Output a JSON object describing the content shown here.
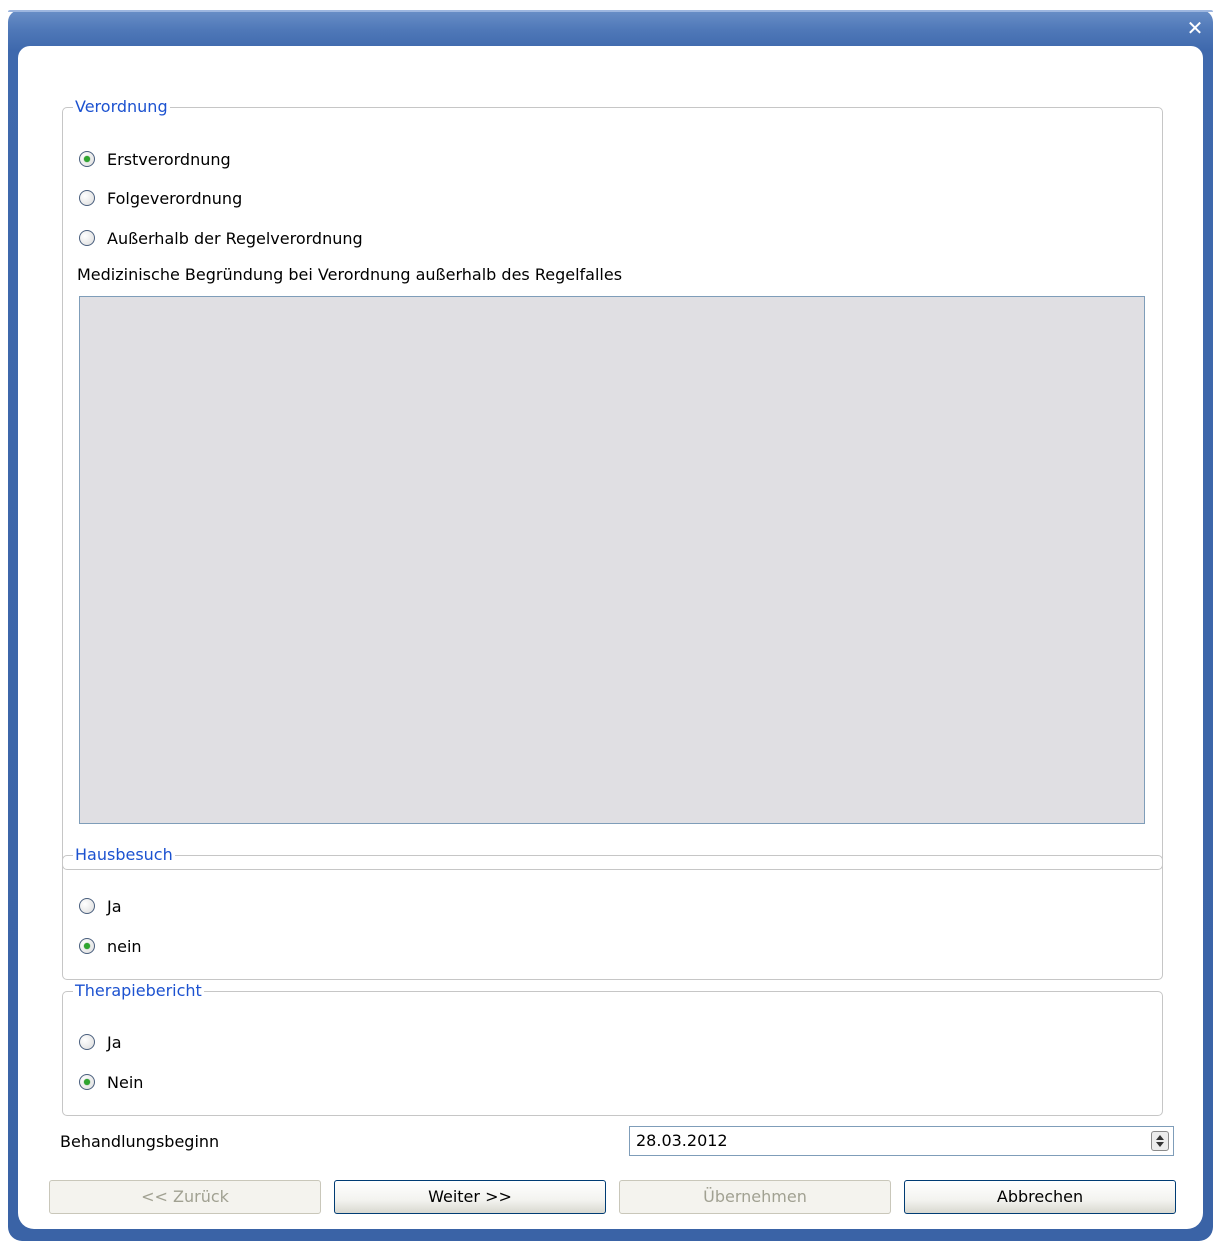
{
  "window": {
    "close_symbol": "✕"
  },
  "verordnung": {
    "legend": "Verordnung",
    "options": [
      {
        "label": "Erstverordnung",
        "checked": true
      },
      {
        "label": "Folgeverordnung",
        "checked": false
      },
      {
        "label": "Außerhalb der Regelverordnung",
        "checked": false
      }
    ],
    "begruendung_label": "Medizinische Begründung bei Verordnung außerhalb des Regelfalles",
    "begruendung_value": ""
  },
  "hausbesuch": {
    "legend": "Hausbesuch",
    "options": [
      {
        "label": "Ja",
        "checked": false
      },
      {
        "label": "nein",
        "checked": true
      }
    ]
  },
  "therapiebericht": {
    "legend": "Therapiebericht",
    "options": [
      {
        "label": "Ja",
        "checked": false
      },
      {
        "label": "Nein",
        "checked": true
      }
    ]
  },
  "behandlungsbeginn": {
    "label": "Behandlungsbeginn",
    "value": "28.03.2012"
  },
  "buttons": {
    "back": "<< Zurück",
    "next": "Weiter >>",
    "apply": "Übernehmen",
    "cancel": "Abbrechen"
  },
  "colors": {
    "legend": "#1c52d0",
    "titlebar": "#3a63a6",
    "textarea_bg": "#e0dfe3"
  }
}
